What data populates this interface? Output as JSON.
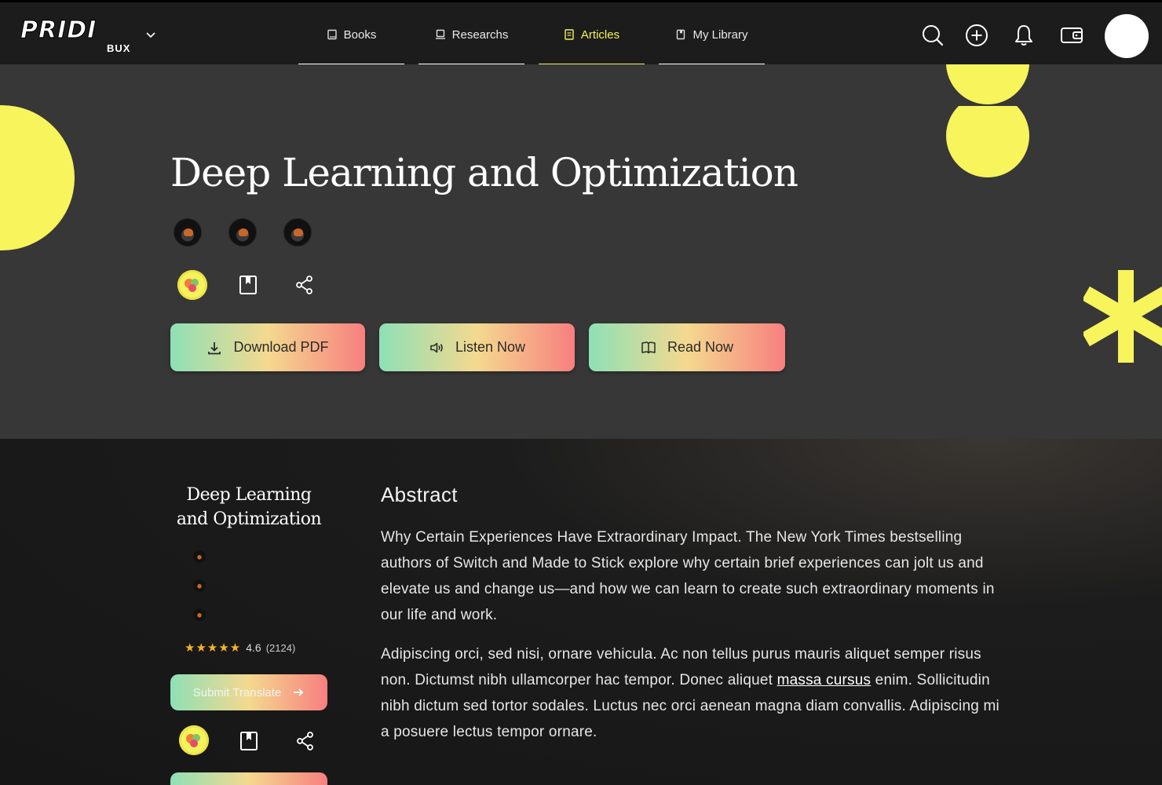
{
  "brand": {
    "logo_text": "PRIDI",
    "logo_sub": "BUX"
  },
  "nav": {
    "tabs": [
      {
        "label": "Books",
        "icon": "book-icon",
        "active": false
      },
      {
        "label": "Researchs",
        "icon": "laptop-icon",
        "active": false
      },
      {
        "label": "Articles",
        "icon": "document-icon",
        "active": true
      },
      {
        "label": "My Library",
        "icon": "bookmark-book-icon",
        "active": false
      }
    ],
    "actions": [
      "search-icon",
      "add-circle-icon",
      "bell-icon",
      "wallet-icon"
    ]
  },
  "hero": {
    "title": "Deep Learning and Optimization",
    "buttons": {
      "download": "Download PDF",
      "listen": "Listen Now",
      "read": "Read Now"
    }
  },
  "sidebar": {
    "title_line1": "Deep Learning",
    "title_line2": "and Optimization",
    "rating": "4.6",
    "rating_count": "(2124)",
    "stars_glyph": "★★★★★",
    "submit_label": "Submit Translate"
  },
  "abstract": {
    "heading": "Abstract",
    "p1": "Why Certain Experiences Have Extraordinary Impact. The New York Times bestselling authors of Switch and Made to Stick explore why certain brief experiences can jolt us and elevate us and change us—and how we can learn to create such extraordinary moments in our life and work.",
    "p2_before": "Adipiscing orci, sed nisi, ornare vehicula. Ac non tellus purus mauris aliquet semper risus non. Dictumst nibh ullamcorper hac tempor. Donec aliquet ",
    "p2_link": "massa cursus",
    "p2_after": " enim. Sollicitudin nibh dictum sed tortor sodales. Luctus nec orci aenean magna diam convallis. Adipiscing mi a posuere lectus tempor ornare."
  },
  "colors": {
    "accent": "#f6f25a",
    "hero_bg": "#373737",
    "page_bg": "#1c1c1c",
    "star": "#f5b326"
  }
}
